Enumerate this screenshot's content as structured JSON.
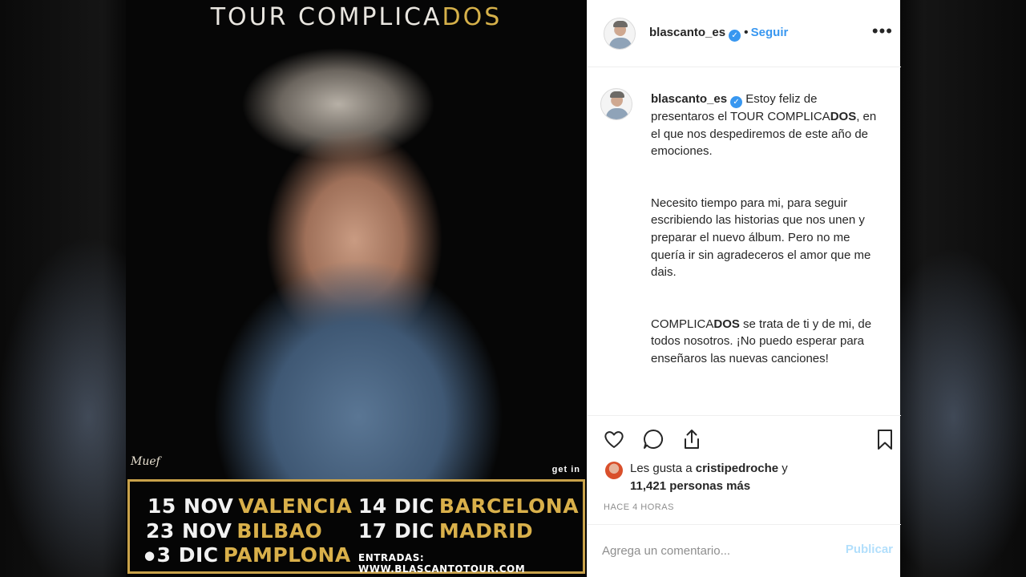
{
  "poster": {
    "title_main": "TOUR COMPLICA",
    "title_accent": "DOS",
    "credit_left": "Muef",
    "credit_right": "get in",
    "dates": [
      {
        "day": "15 NOV",
        "city": "VALENCIA"
      },
      {
        "day": "23 NOV",
        "city": "BILBAO"
      },
      {
        "day": "3 DIC",
        "city": "PAMPLONA"
      },
      {
        "day": "14 DIC",
        "city": "BARCELONA"
      },
      {
        "day": "17 DIC",
        "city": "MADRID"
      }
    ],
    "tickets": "ENTRADAS: WWW.BLASCANTOTOUR.COM"
  },
  "header": {
    "username": "blascanto_es",
    "follow_label": "Seguir",
    "more_label": "•••"
  },
  "caption": {
    "username": "blascanto_es",
    "para1": "Estoy feliz de presentaros el TOUR COMPLICA",
    "para1_bold": "DOS",
    "para1_rest": ", en el que nos despediremos de este año de emociones.",
    "para2": "Necesito tiempo para mi, para seguir escribiendo las historias que nos unen y preparar el nuevo álbum. Pero no me quería ir sin agradeceros el amor que me dais.",
    "para3_a": "COMPLICA",
    "para3_bold": "DOS",
    "para3_rest": " se trata de ti y de mi, de todos nosotros. ¡No puedo esperar para enseñaros las nuevas canciones!"
  },
  "actions": {
    "icons": [
      "heart-icon",
      "comment-icon",
      "share-icon",
      "bookmark-icon"
    ]
  },
  "likes": {
    "prefix": "Les gusta a ",
    "user": "cristipedroche",
    "middle": " y",
    "count": "11,421 personas más"
  },
  "timestamp": "HACE 4 HORAS",
  "comment": {
    "placeholder": "Agrega un comentario...",
    "publish_label": "Publicar"
  },
  "colors": {
    "accent_blue": "#3897f0",
    "poster_gold": "#d9b04a",
    "publish_disabled": "#b2dffc"
  }
}
